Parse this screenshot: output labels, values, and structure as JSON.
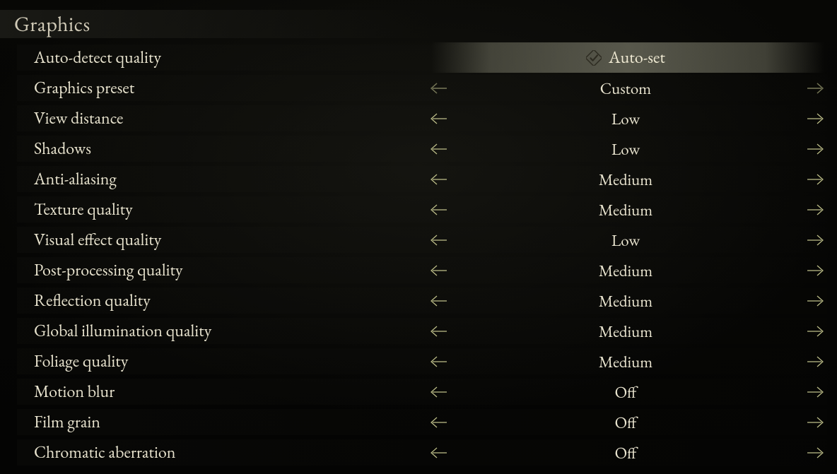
{
  "section_title": "Graphics",
  "autoset_label": "Auto-set",
  "rows": [
    {
      "label": "Auto-detect quality",
      "kind": "action"
    },
    {
      "label": "Graphics preset",
      "kind": "select",
      "value": "Custom"
    },
    {
      "label": "View distance",
      "kind": "select",
      "value": "Low"
    },
    {
      "label": "Shadows",
      "kind": "select",
      "value": "Low"
    },
    {
      "label": "Anti-aliasing",
      "kind": "select",
      "value": "Medium"
    },
    {
      "label": "Texture quality",
      "kind": "select",
      "value": "Medium"
    },
    {
      "label": "Visual effect quality",
      "kind": "select",
      "value": "Low"
    },
    {
      "label": "Post-processing quality",
      "kind": "select",
      "value": "Medium"
    },
    {
      "label": "Reflection quality",
      "kind": "select",
      "value": "Medium"
    },
    {
      "label": "Global illumination quality",
      "kind": "select",
      "value": "Medium"
    },
    {
      "label": "Foliage quality",
      "kind": "select",
      "value": "Medium"
    },
    {
      "label": "Motion blur",
      "kind": "select",
      "value": "Off"
    },
    {
      "label": "Film grain",
      "kind": "select",
      "value": "Off"
    },
    {
      "label": "Chromatic aberration",
      "kind": "select",
      "value": "Off"
    }
  ]
}
